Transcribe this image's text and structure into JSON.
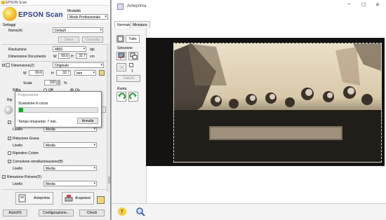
{
  "preview": {
    "title": "Anteprima",
    "tabs": [
      "Normale",
      "Miniatura"
    ],
    "toolbar": {
      "tutto": "Tutto",
      "selezione_label": "Selezione",
      "selezione_count": "1",
      "tutti": "Tutti(A)",
      "ruota_label": "Ruota"
    }
  },
  "scanner": {
    "title": "EPSON Scan",
    "brand": "EPSON Scan",
    "mode_label": "Modalità",
    "mode_value": "Modo Professionale",
    "settings_label": "Settaggi",
    "name_label": "Nome(A)",
    "name_value": "Default",
    "save_button": "Salva",
    "delete_button": "Cancella",
    "resolution_label": "Risoluzione",
    "resolution_value": "4800",
    "resolution_unit": "dpi",
    "doc_size_label": "Dimensione Documento",
    "doc_w_label": "W",
    "doc_w": "69.6",
    "doc_h_label": "H",
    "doc_h": "32.7",
    "doc_unit": "cm",
    "dimension_label": "Dimensione(Z)",
    "dimension_value": "Originale",
    "dim_w_label": "W",
    "dim_w": "69.6",
    "dim_h_label": "H",
    "dim_h": "32.7",
    "dim_unit": "mm",
    "scale_label": "Scala",
    "scale_value": "100",
    "scale_unit": "%",
    "trim_label": "Rifila",
    "trim_off": "Off",
    "trim_on": "On",
    "rep_label": "Rip",
    "livello_label": "Livello",
    "livello_1": "Media",
    "riduzione_grana_label": "Riduzione Grana",
    "livello_2": "Media",
    "ripristino_colore_label": "Ripristino Colore",
    "correzione_label": "Correzione retroilluminazione(B)",
    "livello_3": "Media",
    "rimozione_polvere_label": "Rimozione Polvere(D)",
    "livello_4": "Media",
    "preview_button": "Anteprima",
    "acquire_button": "Acquisisci",
    "help_button": "Aiuto(H)",
    "config_button": "Configurazione...",
    "close_button": "Chiudi"
  },
  "progress": {
    "title": "Progressione",
    "status": "Scansione in corso",
    "fraction": 0.05,
    "time_label": "Tempo rimanente: 7 min.",
    "cancel_button": "Annulla"
  },
  "colors": {
    "progress_fill": "#06b025",
    "brand": "#2a3a84"
  }
}
